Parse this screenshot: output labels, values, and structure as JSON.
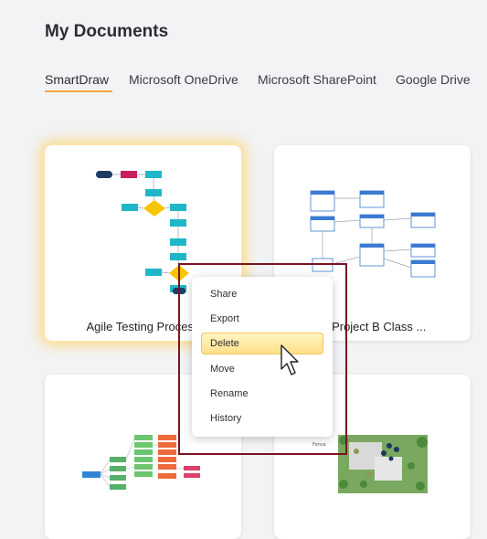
{
  "page": {
    "title": "My Documents"
  },
  "tabs": [
    {
      "label": "SmartDraw",
      "active": true
    },
    {
      "label": "Microsoft OneDrive",
      "active": false
    },
    {
      "label": "Microsoft SharePoint",
      "active": false
    },
    {
      "label": "Google Drive",
      "active": false
    }
  ],
  "cards": [
    {
      "title": "Agile Testing Process",
      "selected": true
    },
    {
      "title": "m Project B Class ...",
      "selected": false
    },
    {
      "title": "",
      "selected": false
    },
    {
      "title": "",
      "selected": false
    }
  ],
  "context_menu": {
    "items": [
      {
        "label": "Share"
      },
      {
        "label": "Export"
      },
      {
        "label": "Delete",
        "highlighted": true
      },
      {
        "label": "Move"
      },
      {
        "label": "Rename"
      },
      {
        "label": "History"
      }
    ]
  },
  "colors": {
    "accent_underline": "#f2a93b",
    "selection_glow": "#ffd166",
    "annotation_box": "#7b1222",
    "menu_hover": "#ffe08a"
  }
}
